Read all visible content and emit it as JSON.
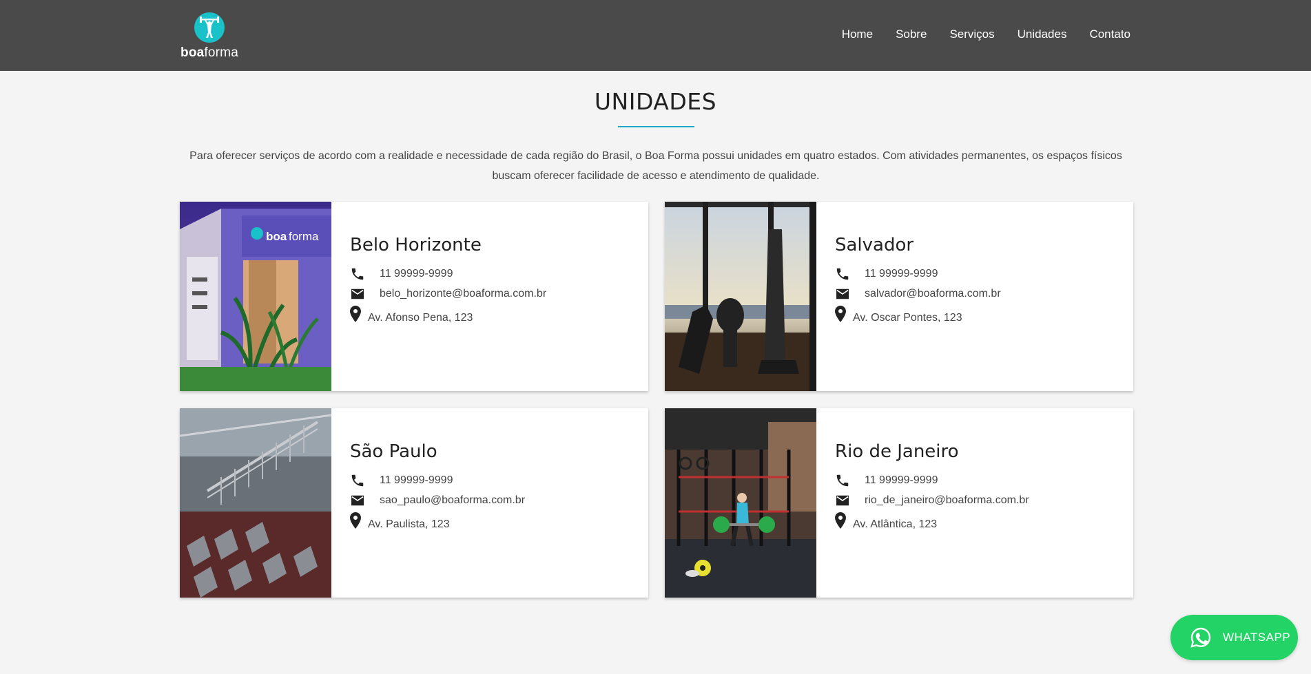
{
  "brand": {
    "logo_bold": "boa",
    "logo_light": "forma",
    "accent": "#19c2c9"
  },
  "nav": {
    "items": [
      {
        "label": "Home"
      },
      {
        "label": "Sobre"
      },
      {
        "label": "Serviços"
      },
      {
        "label": "Unidades"
      },
      {
        "label": "Contato"
      }
    ]
  },
  "section": {
    "title": "UNIDADES",
    "intro": "Para oferecer serviços de acordo com a realidade e necessidade de cada região do Brasil, o Boa Forma possui unidades em quatro estados. Com atividades permanentes, os espaços físicos buscam oferecer facilidade de acesso e atendimento de qualidade."
  },
  "units": [
    {
      "city": "Belo Horizonte",
      "phone": "11 99999-9999",
      "email": "belo_horizonte@boaforma.com.br",
      "address": "Av. Afonso Pena, 123",
      "image_sign": "boaforma"
    },
    {
      "city": "Salvador",
      "phone": "11 99999-9999",
      "email": "salvador@boaforma.com.br",
      "address": "Av. Oscar Pontes, 123"
    },
    {
      "city": "São Paulo",
      "phone": "11 99999-9999",
      "email": "sao_paulo@boaforma.com.br",
      "address": "Av. Paulista, 123"
    },
    {
      "city": "Rio de Janeiro",
      "phone": "11 99999-9999",
      "email": "rio_de_janeiro@boaforma.com.br",
      "address": "Av. Atlântica, 123"
    }
  ],
  "whatsapp": {
    "label": "WHATSAPP",
    "color": "#23d366"
  }
}
